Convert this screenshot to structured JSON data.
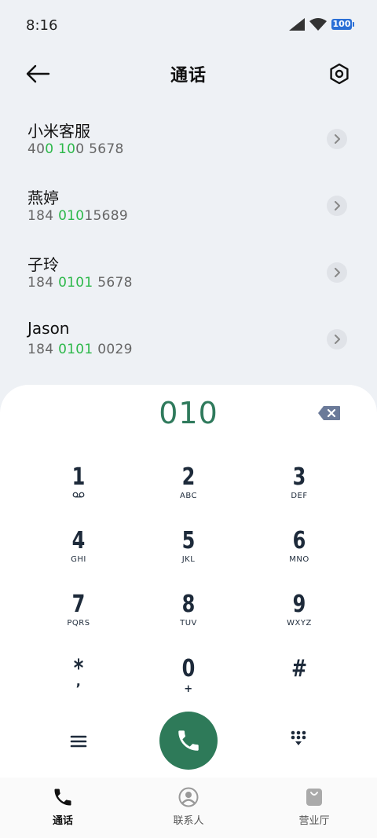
{
  "status_bar": {
    "time": "8:16",
    "battery": "100",
    "icons": [
      "cellular-signal-icon",
      "wifi-icon",
      "battery-icon"
    ]
  },
  "header": {
    "title": "通话",
    "back_icon": "arrow-left-icon",
    "settings_icon": "settings-hexagon-icon"
  },
  "contacts": [
    {
      "name": "小米客服",
      "number_parts": [
        "40",
        "0 10",
        "0 5678"
      ]
    },
    {
      "name": "燕婷",
      "number_parts": [
        "184 ",
        "010",
        "15689"
      ]
    },
    {
      "name": "子玲",
      "number_parts": [
        "184 ",
        "0101",
        " 5678"
      ]
    },
    {
      "name": "Jason",
      "number_parts": [
        "184 ",
        "0101",
        " 0029"
      ]
    }
  ],
  "dialpad": {
    "dialed": "010",
    "keys": [
      {
        "digit": "1",
        "letters": "voicemail-icon"
      },
      {
        "digit": "2",
        "letters": "ABC"
      },
      {
        "digit": "3",
        "letters": "DEF"
      },
      {
        "digit": "4",
        "letters": "GHI"
      },
      {
        "digit": "5",
        "letters": "JKL"
      },
      {
        "digit": "6",
        "letters": "MNO"
      },
      {
        "digit": "7",
        "letters": "PQRS"
      },
      {
        "digit": "8",
        "letters": "TUV"
      },
      {
        "digit": "9",
        "letters": "WXYZ"
      },
      {
        "digit": "*",
        "letters": ","
      },
      {
        "digit": "0",
        "letters": "+"
      },
      {
        "digit": "#",
        "letters": ""
      }
    ]
  },
  "bottom_nav": {
    "items": [
      {
        "label": "通话",
        "icon": "phone-icon",
        "active": true
      },
      {
        "label": "联系人",
        "icon": "contacts-icon",
        "active": false
      },
      {
        "label": "营业厅",
        "icon": "store-bag-icon",
        "active": false
      }
    ]
  },
  "colors": {
    "accent": "#2e7a59",
    "highlight": "#2db84a",
    "dialed_text": "#2f7a5c",
    "battery": "#2a6fd6"
  }
}
